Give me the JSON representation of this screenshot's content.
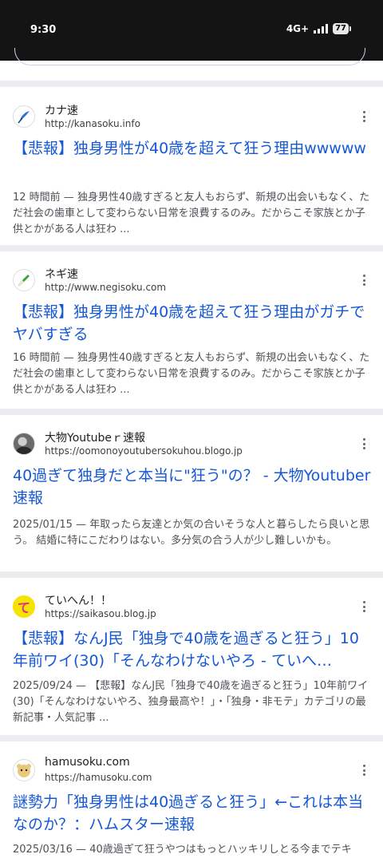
{
  "status": {
    "time": "9:30",
    "network": "4G+",
    "battery": "77"
  },
  "results": [
    {
      "site_name": "カナ速",
      "url": "http://kanasoku.info",
      "title": "【悲報】独身男性が40歳を超えて狂う理由wwwww",
      "snippet": "12 時間前 — 独身男性40歳すぎると友人もおらず、新規の出会いもなく、ただ社会の歯車として変わらない日常を浪費するのみ。だからこそ家族とか子供とかがある人は狂わ ..."
    },
    {
      "site_name": "ネギ速",
      "url": "http://www.negisoku.com",
      "title": "【悲報】独身男性が40歳を超えて狂う理由がガチでヤバすぎる",
      "snippet": "16 時間前 — 独身男性40歳すぎると友人もおらず、新規の出会いもなく、ただ社会の歯車として変わらない日常を浪費するのみ。だからこそ家族とか子供とかがある人は狂わ ..."
    },
    {
      "site_name": "大物Youtubeｒ速報",
      "url": "https://oomonoyoutubersokuhou.blogo.jp",
      "title": "40過ぎて独身だと本当に\"狂う\"の？ - 大物Youtuber速報",
      "snippet": "2025/01/15 — 年取ったら友達とか気の合いそうな人と暮らしたら良いと思う。 結婚に特にこだわりはない。多分気の合う人が少し難しいかも。"
    },
    {
      "site_name": "ていへん！！",
      "url": "https://saikasou.blog.jp",
      "title": "【悲報】なんJ民「独身で40歳を過ぎると狂う」10年前ワイ(30)「そんなわけないやろ - ていへ…",
      "snippet": "2025/09/24 — 【悲報】なんJ民「独身で40歳を過ぎると狂う」10年前ワイ(30)「そんなわけないやろ、独身最高や！」・「独身・非モテ」カテゴリの最新記事・人気記事 ..."
    },
    {
      "site_name": "hamusoku.com",
      "url": "https://hamusoku.com",
      "title": "謎勢力「独身男性は40過ぎると狂う」←これは本当なのか？：ハムスター速報",
      "snippet": "2025/03/16 — 40歳過ぎて狂うやつはもっとハッキリしとる今までテキ"
    }
  ]
}
